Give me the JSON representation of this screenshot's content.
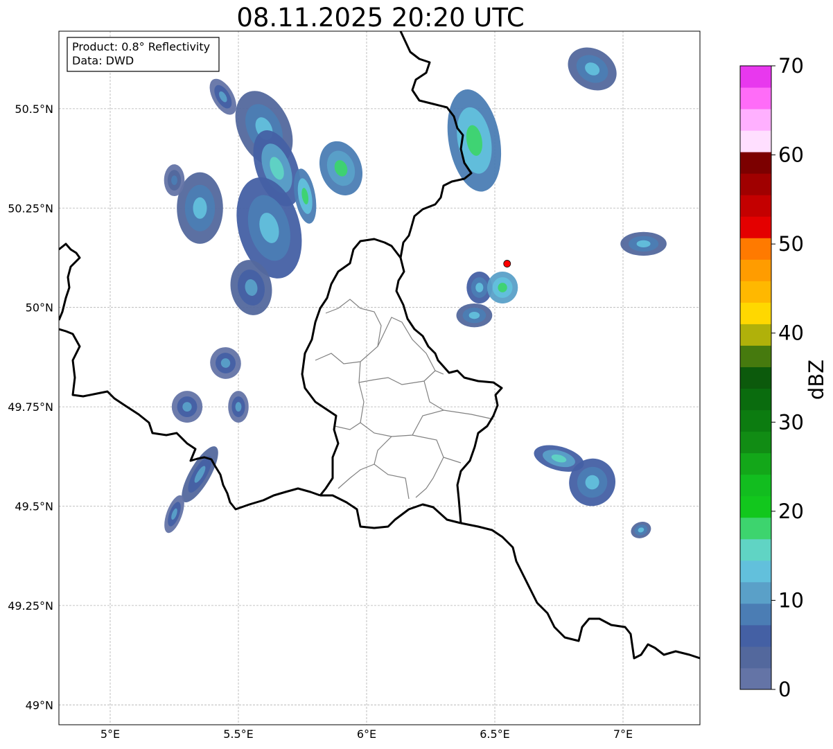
{
  "title": "08.11.2025 20:20 UTC",
  "info_box": {
    "product": "Product: 0.8° Reflectivity",
    "source": "Data: DWD"
  },
  "map": {
    "lon_range": [
      4.8,
      7.3
    ],
    "lat_range": [
      48.95,
      50.695
    ],
    "grid": true,
    "lon_ticks": [
      {
        "value": 5.0,
        "label": "5°E"
      },
      {
        "value": 5.5,
        "label": "5.5°E"
      },
      {
        "value": 6.0,
        "label": "6°E"
      },
      {
        "value": 6.5,
        "label": "6.5°E"
      },
      {
        "value": 7.0,
        "label": "7°E"
      }
    ],
    "lat_ticks": [
      {
        "value": 50.5,
        "label": "50.5°N"
      },
      {
        "value": 50.25,
        "label": "50.25°N"
      },
      {
        "value": 50.0,
        "label": "50°N"
      },
      {
        "value": 49.75,
        "label": "49.75°N"
      },
      {
        "value": 49.5,
        "label": "49.5°N"
      },
      {
        "value": 49.25,
        "label": "49.25°N"
      },
      {
        "value": 49.0,
        "label": "49°N"
      }
    ],
    "radar_site": {
      "lon": 6.548,
      "lat": 50.11,
      "color": "#ff0000"
    },
    "precipitation_cells": [
      {
        "lon": 5.6,
        "lat": 50.45,
        "rlon": 0.1,
        "rlat": 0.1,
        "rot": -25,
        "dbz": 10
      },
      {
        "lon": 5.65,
        "lat": 50.35,
        "rlon": 0.08,
        "rlat": 0.1,
        "rot": -20,
        "dbz": 12
      },
      {
        "lon": 5.62,
        "lat": 50.2,
        "rlon": 0.12,
        "rlat": 0.13,
        "rot": -15,
        "dbz": 11
      },
      {
        "lon": 5.55,
        "lat": 50.05,
        "rlon": 0.08,
        "rlat": 0.07,
        "rot": -10,
        "dbz": 9
      },
      {
        "lon": 5.35,
        "lat": 50.25,
        "rlon": 0.09,
        "rlat": 0.09,
        "rot": 0,
        "dbz": 10
      },
      {
        "lon": 5.25,
        "lat": 50.32,
        "rlon": 0.04,
        "rlat": 0.04,
        "rot": 0,
        "dbz": 6
      },
      {
        "lon": 5.9,
        "lat": 50.35,
        "rlon": 0.08,
        "rlat": 0.07,
        "rot": -20,
        "dbz": 14
      },
      {
        "lon": 5.76,
        "lat": 50.28,
        "rlon": 0.04,
        "rlat": 0.07,
        "rot": -10,
        "dbz": 15
      },
      {
        "lon": 5.44,
        "lat": 50.53,
        "rlon": 0.04,
        "rlat": 0.05,
        "rot": -30,
        "dbz": 8
      },
      {
        "lon": 6.42,
        "lat": 50.42,
        "rlon": 0.1,
        "rlat": 0.13,
        "rot": -10,
        "dbz": 15
      },
      {
        "lon": 6.88,
        "lat": 50.6,
        "rlon": 0.1,
        "rlat": 0.05,
        "rot": 30,
        "dbz": 10
      },
      {
        "lon": 7.08,
        "lat": 50.16,
        "rlon": 0.09,
        "rlat": 0.03,
        "rot": 0,
        "dbz": 10
      },
      {
        "lon": 6.44,
        "lat": 50.05,
        "rlon": 0.05,
        "rlat": 0.04,
        "rot": 0,
        "dbz": 11
      },
      {
        "lon": 6.53,
        "lat": 50.05,
        "rlon": 0.06,
        "rlat": 0.04,
        "rot": 0,
        "dbz": 16
      },
      {
        "lon": 6.42,
        "lat": 49.98,
        "rlon": 0.07,
        "rlat": 0.03,
        "rot": 0,
        "dbz": 10
      },
      {
        "lon": 5.45,
        "lat": 49.86,
        "rlon": 0.06,
        "rlat": 0.04,
        "rot": -20,
        "dbz": 8
      },
      {
        "lon": 5.3,
        "lat": 49.75,
        "rlon": 0.06,
        "rlat": 0.04,
        "rot": 0,
        "dbz": 8
      },
      {
        "lon": 5.5,
        "lat": 49.75,
        "rlon": 0.04,
        "rlat": 0.04,
        "rot": 0,
        "dbz": 8
      },
      {
        "lon": 5.35,
        "lat": 49.58,
        "rlon": 0.04,
        "rlat": 0.08,
        "rot": 30,
        "dbz": 9
      },
      {
        "lon": 5.25,
        "lat": 49.48,
        "rlon": 0.03,
        "rlat": 0.05,
        "rot": 20,
        "dbz": 8
      },
      {
        "lon": 6.75,
        "lat": 49.62,
        "rlon": 0.1,
        "rlat": 0.03,
        "rot": 15,
        "dbz": 12
      },
      {
        "lon": 6.88,
        "lat": 49.56,
        "rlon": 0.09,
        "rlat": 0.06,
        "rot": 20,
        "dbz": 11
      },
      {
        "lon": 7.07,
        "lat": 49.44,
        "rlon": 0.04,
        "rlat": 0.02,
        "rot": -20,
        "dbz": 10
      }
    ]
  },
  "colorbar": {
    "label": "dBZ",
    "min": 0,
    "max": 70,
    "ticks": [
      {
        "value": 0,
        "label": "0"
      },
      {
        "value": 10,
        "label": "10"
      },
      {
        "value": 20,
        "label": "20"
      },
      {
        "value": 30,
        "label": "30"
      },
      {
        "value": 40,
        "label": "40"
      },
      {
        "value": 50,
        "label": "50"
      },
      {
        "value": 60,
        "label": "60"
      },
      {
        "value": 70,
        "label": "70"
      }
    ],
    "colors": [
      "#6474a6",
      "#53689d",
      "#4460a4",
      "#4b7db4",
      "#5aa0c8",
      "#62c0dc",
      "#60d4c4",
      "#3dd46e",
      "#12c71d",
      "#12bd1f",
      "#13a719",
      "#118c14",
      "#0c7c10",
      "#0a6c0e",
      "#0c5a0c",
      "#467a0e",
      "#b0b10a",
      "#ffd800",
      "#ffb800",
      "#ff9c00",
      "#ff7a00",
      "#e40000",
      "#c40000",
      "#a00000",
      "#7c0000",
      "#ffdfff",
      "#ffb0ff",
      "#ff6cf8",
      "#e838ee"
    ]
  }
}
